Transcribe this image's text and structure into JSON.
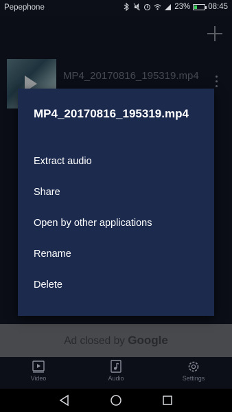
{
  "status_bar": {
    "carrier": "Pepephone",
    "battery": "23%",
    "battery_level": 0.23,
    "time": "08:45"
  },
  "app_bar": {
    "add_icon": "plus-icon"
  },
  "file_list": [
    {
      "name": "MP4_20170816_195319.mp4"
    }
  ],
  "dialog": {
    "title": "MP4_20170816_195319.mp4",
    "items": [
      {
        "label": "Extract audio"
      },
      {
        "label": "Share"
      },
      {
        "label": "Open by other applications"
      },
      {
        "label": "Rename"
      },
      {
        "label": "Delete"
      }
    ]
  },
  "ad_bar": {
    "text": "Ad closed by ",
    "brand": "Google"
  },
  "bottom_nav": {
    "items": [
      {
        "label": "Video",
        "icon": "video-icon"
      },
      {
        "label": "Audio",
        "icon": "audio-icon"
      },
      {
        "label": "Settings",
        "icon": "gear-icon"
      }
    ]
  },
  "colors": {
    "dialog_bg": "#1c2a4e",
    "app_bg": "#111624",
    "ad_bg": "#6f7176"
  }
}
